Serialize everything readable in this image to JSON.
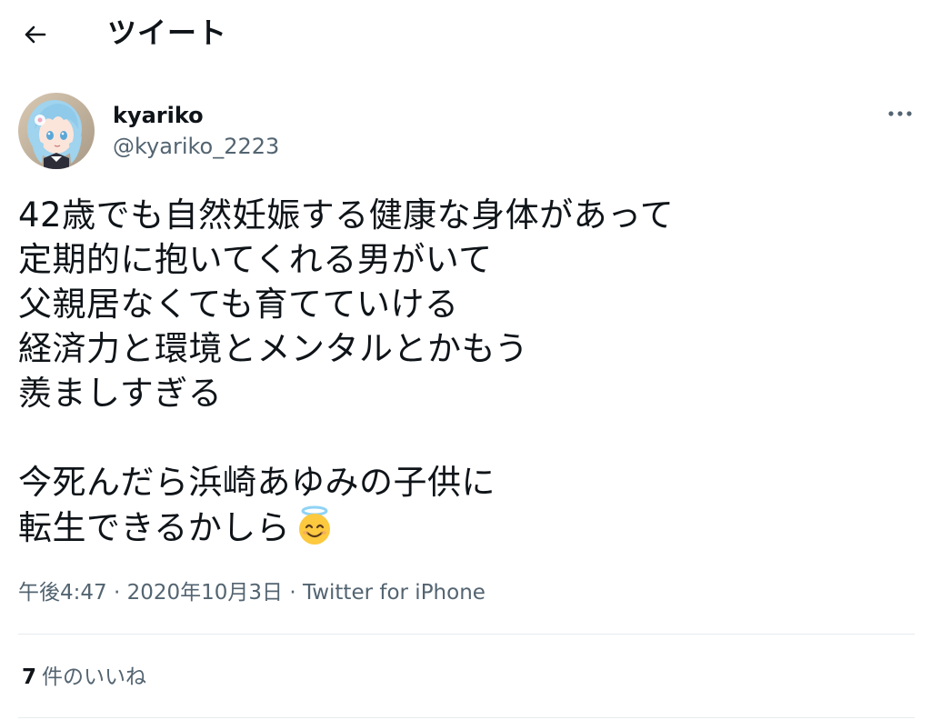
{
  "header": {
    "title": "ツイート",
    "back_icon": "arrow-left-icon"
  },
  "author": {
    "display_name": "kyariko",
    "handle": "@kyariko_2223",
    "avatar": "anime-character-avatar"
  },
  "tweet": {
    "lines": [
      "42歳でも自然妊娠する健康な身体があって",
      "定期的に抱いてくれる男がいて",
      "父親居なくても育てていける",
      "経済力と環境とメンタルとかもう",
      "羨ましすぎる",
      "",
      "今死んだら浜崎あゆみの子供に",
      "転生できるかしら"
    ],
    "emoji": "smiling-face-with-halo-emoji"
  },
  "meta": {
    "time": "午後4:47",
    "separator": "·",
    "date": "2020年10月3日",
    "source": "Twitter for iPhone"
  },
  "stats": {
    "likes_count": "7",
    "likes_label": "件のいいね"
  },
  "colors": {
    "text": "#0f1419",
    "secondary": "#536471",
    "divider": "#e6ecf0",
    "background": "#ffffff"
  }
}
